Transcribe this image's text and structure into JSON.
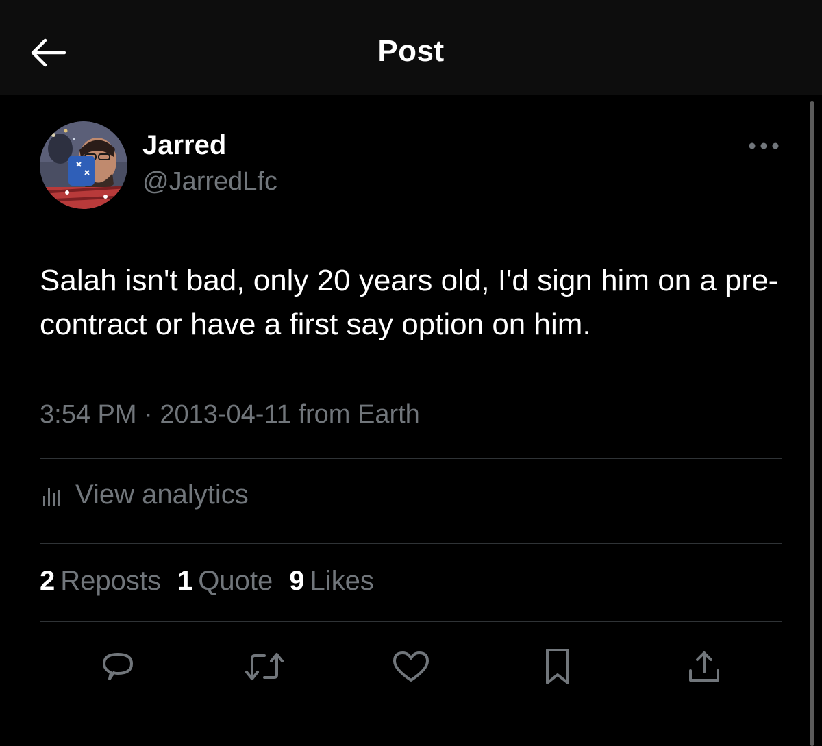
{
  "header": {
    "title": "Post",
    "back_icon": "arrow-left-icon"
  },
  "post": {
    "author": {
      "name": "Jarred",
      "handle": "@JarredLfc"
    },
    "text": "Salah isn't bad, only 20 years old, I'd sign him on a pre-contract or have a first say option on him.",
    "time": "3:54 PM",
    "separator": "·",
    "date": "2013-04-11",
    "source": "from Earth",
    "analytics_label": "View analytics",
    "stats": [
      {
        "count": "2",
        "label": "Reposts"
      },
      {
        "count": "1",
        "label": "Quote"
      },
      {
        "count": "9",
        "label": "Likes"
      }
    ],
    "actions": [
      "reply-icon",
      "repost-icon",
      "like-icon",
      "bookmark-icon",
      "share-icon"
    ]
  },
  "colors": {
    "background": "#000000",
    "header_bg": "#0d0d0d",
    "text_primary": "#ffffff",
    "text_secondary": "#71767b",
    "divider": "#2f3336"
  }
}
